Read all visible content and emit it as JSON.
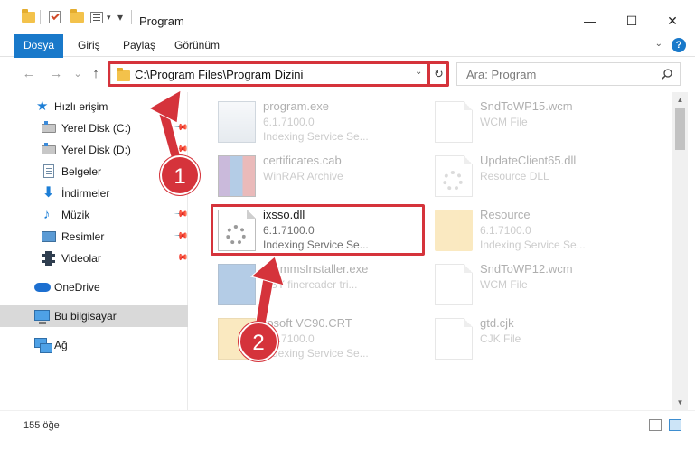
{
  "window": {
    "title": "Program",
    "controls": {
      "minimize": "—",
      "maximize": "☐",
      "close": "✕"
    }
  },
  "ribbon": {
    "tabs": [
      {
        "label": "Dosya"
      },
      {
        "label": "Giriş"
      },
      {
        "label": "Paylaş"
      },
      {
        "label": "Görünüm"
      }
    ],
    "help": "?"
  },
  "nav": {
    "back": "←",
    "forward": "→",
    "recent": "⌄",
    "up": "↑"
  },
  "address": {
    "path": "C:\\Program Files\\Program Dizini",
    "refresh": "↻"
  },
  "search": {
    "placeholder": "Ara: Program"
  },
  "sidebar": {
    "items": [
      {
        "label": "Hızlı erişim"
      },
      {
        "label": "Yerel Disk (C:)"
      },
      {
        "label": "Yerel Disk (D:)"
      },
      {
        "label": "Belgeler"
      },
      {
        "label": "İndirmeler"
      },
      {
        "label": "Müzik"
      },
      {
        "label": "Resimler"
      },
      {
        "label": "Videolar"
      },
      {
        "label": "OneDrive"
      },
      {
        "label": "Bu bilgisayar"
      },
      {
        "label": "Ağ"
      }
    ]
  },
  "files": [
    {
      "name": "program.exe",
      "version": "6.1.7100.0",
      "desc": "Indexing Service Se..."
    },
    {
      "name": "SndToWP15.wcm",
      "version": "",
      "desc": "WCM File"
    },
    {
      "name": "certificates.cab",
      "version": "",
      "desc": "WinRAR Archive"
    },
    {
      "name": "UpdateClient65.dll",
      "version": "",
      "desc": "Resource DLL"
    },
    {
      "name": "ixsso.dll",
      "version": "6.1.7100.0",
      "desc": "Indexing Service Se..."
    },
    {
      "name": "Resource",
      "version": "6.1.7100.0",
      "desc": "Indexing Service Se..."
    },
    {
      "name": "grammsInstaller.exe",
      "version": "",
      "desc": "BBY finereader tri..."
    },
    {
      "name": "SndToWP12.wcm",
      "version": "",
      "desc": "WCM File"
    },
    {
      "name": "rosoft VC90.CRT",
      "version": "6.1.7100.0",
      "desc": "Indexing Service Se..."
    },
    {
      "name": "gtd.cjk",
      "version": "",
      "desc": "CJK File"
    }
  ],
  "status": {
    "count": "155 öğe"
  },
  "annotations": {
    "badge1": "1",
    "badge2": "2"
  },
  "colors": {
    "accent": "#1979ca",
    "highlight": "#d5333b"
  }
}
